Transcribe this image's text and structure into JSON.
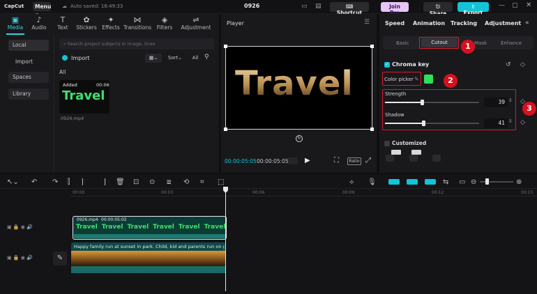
{
  "topbar": {
    "logo": "CapCut",
    "menu": "Menu",
    "saved": "Auto saved: 16:49:33",
    "project_title": "0926",
    "shortcut": "Shortcut",
    "join_pro": "Join Pro",
    "share": "Share",
    "export": "Export"
  },
  "left_tabs": [
    {
      "icon": "▣",
      "label": "Media"
    },
    {
      "icon": "♪",
      "label": "Audio"
    },
    {
      "icon": "T",
      "label": "Text"
    },
    {
      "icon": "✿",
      "label": "Stickers"
    },
    {
      "icon": "✦",
      "label": "Effects"
    },
    {
      "icon": "⋈",
      "label": "Transitions"
    },
    {
      "icon": "◈",
      "label": "Filters"
    },
    {
      "icon": "⇌",
      "label": "Adjustment"
    }
  ],
  "sidebar": {
    "local": "Local",
    "import": "Import",
    "spaces": "Spaces",
    "library": "Library"
  },
  "media": {
    "search_placeholder": "Search project subjects in image, lines",
    "import": "Import",
    "sort": "Sort",
    "all_filter": "All",
    "all_label": "All",
    "clip_added": "Added",
    "clip_duration": "00:06",
    "clip_title": "Travel",
    "clip_file": "0926.mp4"
  },
  "player": {
    "title": "Player",
    "preview_text": "Travel",
    "time_current": "00:00:05:05",
    "time_total": "00:00:05:05",
    "ratio": "Ratio"
  },
  "right": {
    "tabs": [
      "Speed",
      "Animation",
      "Tracking",
      "Adjustment"
    ],
    "subtabs": [
      "Basic",
      "Cutout",
      "Mask",
      "Enhance"
    ],
    "chroma_key": "Chroma key",
    "color_picker": "Color picker",
    "picker_color": "#2fe05a",
    "strength_label": "Strength",
    "strength_value": "39",
    "strength_level": 39,
    "shadow_label": "Shadow",
    "shadow_value": "41",
    "shadow_level": 41,
    "customized": "Customized"
  },
  "annotations": [
    "1",
    "2",
    "3"
  ],
  "timeline": {
    "ticks": [
      "00:00",
      "00:03",
      "00:06",
      "00:09",
      "00:12",
      "00:15"
    ],
    "clip1_name": "0926.mp4",
    "clip1_time": "00:00:05:02",
    "clip1_word": "Travel",
    "clip2_caption": "Happy family run at sunset in park. Child, kid and parents run on green"
  },
  "colors": {
    "accent": "#12c4d6",
    "brand_pink": "#e4c6f7",
    "red": "#e0182a"
  }
}
